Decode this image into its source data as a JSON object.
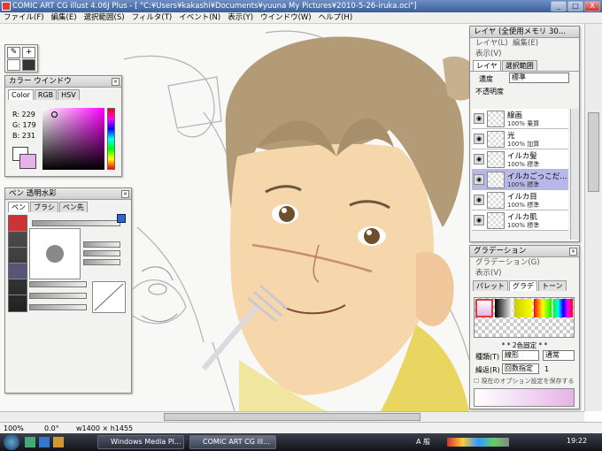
{
  "window": {
    "title": "COMIC ART CG illust 4.06J Plus - [ \"C:¥Users¥kakashi¥Documents¥yuuna My Pictures¥2010-5-26-iruka.oci\"]",
    "minimize": "_",
    "maximize": "□",
    "close": "X"
  },
  "menu": [
    "ファイル(F)",
    "編集(E)",
    "選択範囲(S)",
    "フィルタ(T)",
    "イベント(N)",
    "表示(Y)",
    "ウインドウ(W)",
    "ヘルプ(H)"
  ],
  "color_window": {
    "title": "カラー ウインドウ",
    "tabs": [
      "Color",
      "RGB",
      "HSV"
    ],
    "r": "R: 229",
    "g": "G: 179",
    "b": "B: 231",
    "current_color": "#e5b3e7"
  },
  "brush_window": {
    "title": "ペン 透明水彩",
    "tabs": [
      "ペン",
      "ブラシ",
      "ペン先"
    ]
  },
  "layer_panel": {
    "title": "レイヤ (全使用メモリ 30...",
    "menu": [
      "レイヤ(L)",
      "編集(E)",
      "表示(V)"
    ],
    "tabs": [
      "レイヤ",
      "選択範囲"
    ],
    "blend_label": "濃度",
    "blend_value": "標準",
    "opacity_label": "不透明度",
    "layers": [
      {
        "name": "線画",
        "info": "100% 乗算"
      },
      {
        "name": "光",
        "info": "100% 加算"
      },
      {
        "name": "イルカ髪",
        "info": "100% 標準"
      },
      {
        "name": "イルカごっこだ...",
        "info": "100% 標準"
      },
      {
        "name": "イルカ目",
        "info": "100% 標準"
      },
      {
        "name": "イルカ肌",
        "info": "100% 標準"
      }
    ]
  },
  "gradation_panel": {
    "title": "グラデーション",
    "menu": [
      "グラデーション(G)",
      "表示(V)"
    ],
    "tabs": [
      "パレット",
      "グラデ",
      "トーン"
    ],
    "fixed_label": "* * 2色固定 * *",
    "type_label": "種類(T)",
    "type_value": "線形",
    "mode_value": "通常",
    "repeat_label": "繰返(R)",
    "repeat_value": "回数指定",
    "repeat_count": "1",
    "save_option": "現在のオプション設定を保存する"
  },
  "status": {
    "zoom": "100%",
    "angle": "0.0°",
    "size": "w1400 × h1455"
  },
  "taskbar": {
    "tasks": [
      "Windows Media Pl...",
      "COMIC ART CG ill..."
    ],
    "tray": "A 般",
    "clock": "19:22"
  }
}
